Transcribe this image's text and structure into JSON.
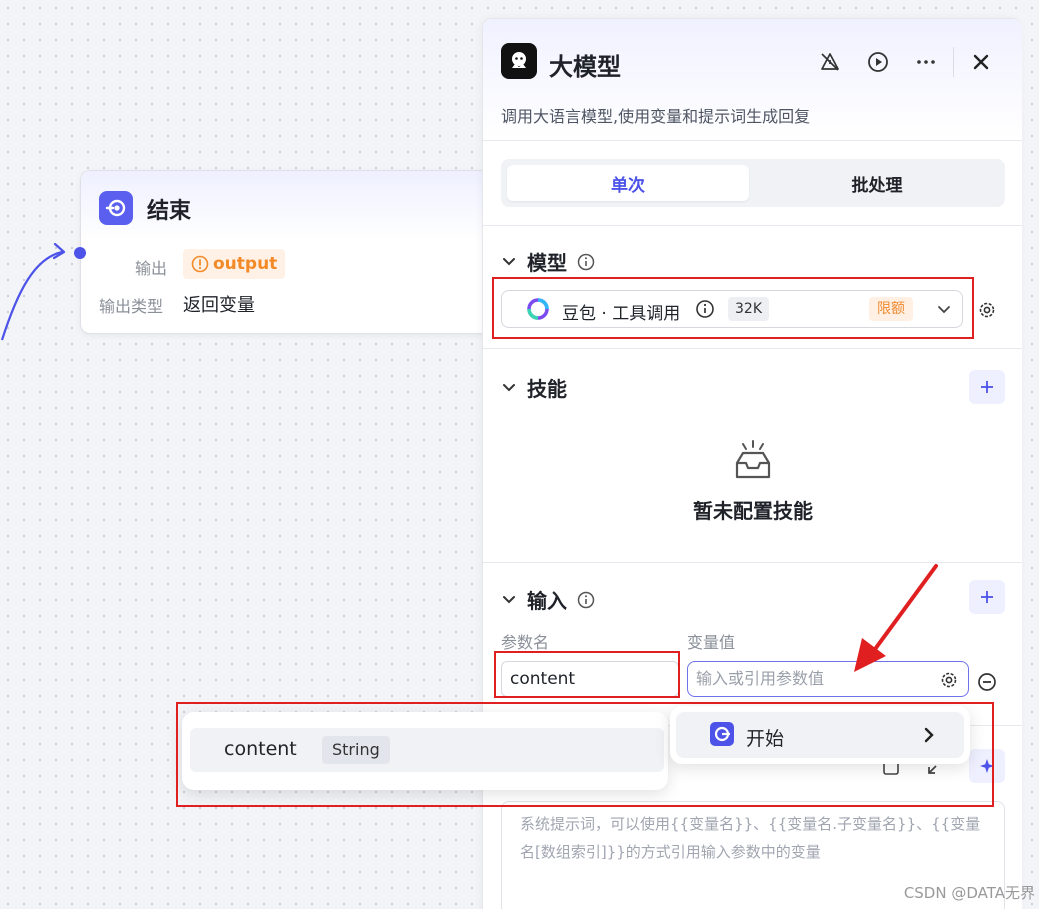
{
  "end_node": {
    "title": "结束",
    "output_label": "输出",
    "output_value": "output",
    "output_type_label": "输出类型",
    "output_type_value": "返回变量"
  },
  "panel": {
    "title": "大模型",
    "description": "调用大语言模型,使用变量和提示词生成回复",
    "tabs": [
      "单次",
      "批处理"
    ],
    "active_tab": "单次",
    "model_section": {
      "title": "模型",
      "model_name": "豆包 · 工具调用",
      "context": "32K",
      "limit_badge": "限额"
    },
    "skills_section": {
      "title": "技能",
      "empty_text": "暂未配置技能"
    },
    "input_section": {
      "title": "输入",
      "col_param": "参数名",
      "col_value": "变量值",
      "param_value": "content",
      "value_placeholder": "输入或引用参数值"
    },
    "system_prompt_placeholder": "系统提示词，可以使用{{变量名}}、{{变量名.子变量名}}、{{变量名[数组索引]}}的方式引用输入参数中的变量"
  },
  "popup_variables": {
    "items": [
      {
        "name": "content",
        "type": "String"
      }
    ]
  },
  "popup_nodes": {
    "items": [
      {
        "label": "开始"
      }
    ]
  },
  "watermark": "CSDN @DATA无界",
  "colors": {
    "accent": "#4d53e8",
    "warning": "#f38a28",
    "annotation_red": "#e02020"
  }
}
